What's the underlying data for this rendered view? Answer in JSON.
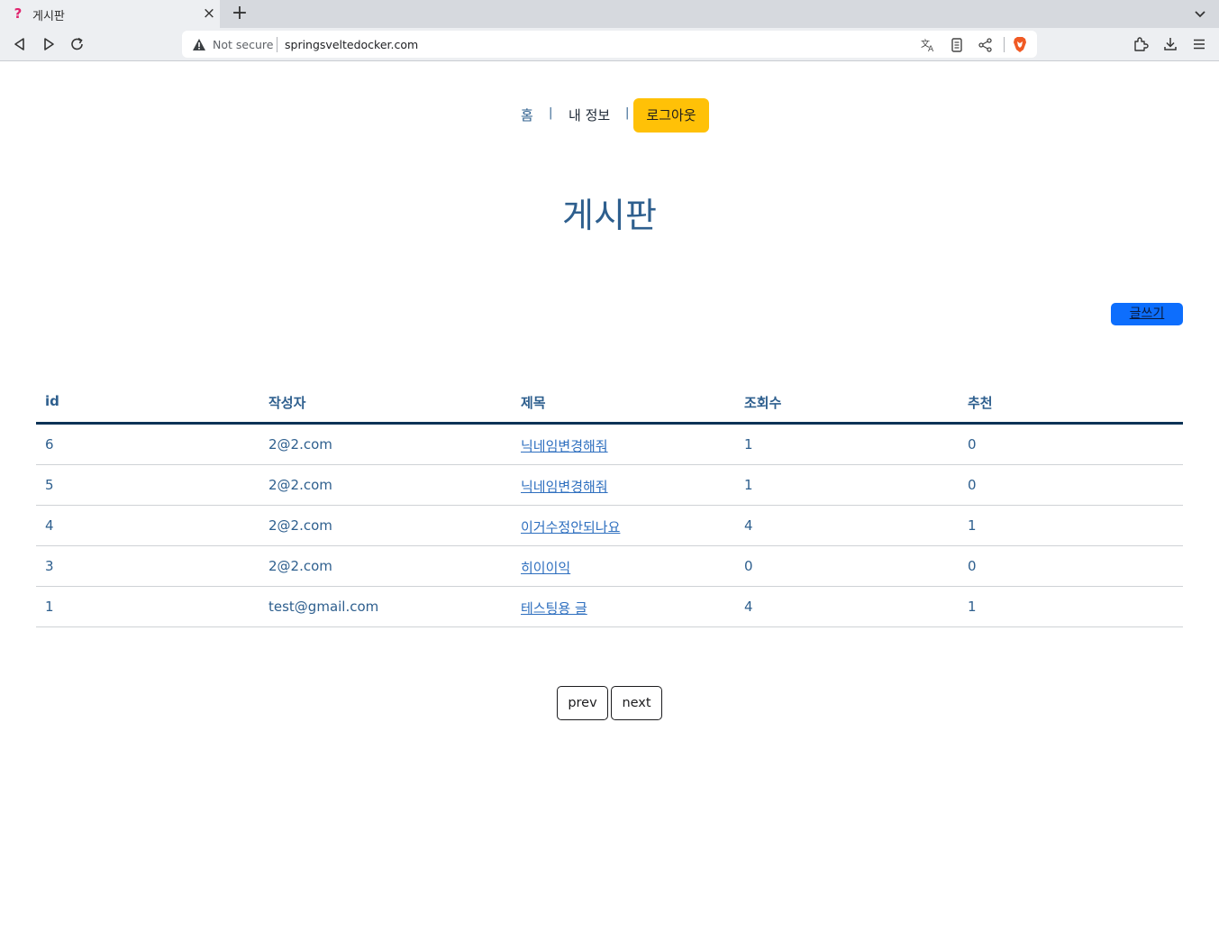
{
  "browser": {
    "tab_title": "게시판",
    "tab_close": "×",
    "new_tab": "+",
    "security_label": "Not secure",
    "url": "springsveltedocker.com"
  },
  "nav": {
    "home": "홈",
    "separator": "|",
    "my_info": "내 정보",
    "logout": "로그아웃"
  },
  "page": {
    "title": "게시판",
    "write_button": "글쓰기"
  },
  "table": {
    "columns": [
      "id",
      "작성자",
      "제목",
      "조회수",
      "추천"
    ],
    "rows": [
      {
        "id": "6",
        "author": "2@2.com",
        "title": "닉네임변경해줘",
        "views": "1",
        "likes": "0"
      },
      {
        "id": "5",
        "author": "2@2.com",
        "title": "닉네임변경해줘",
        "views": "1",
        "likes": "0"
      },
      {
        "id": "4",
        "author": "2@2.com",
        "title": "이거수정안되나요",
        "views": "4",
        "likes": "1"
      },
      {
        "id": "3",
        "author": "2@2.com",
        "title": "히이이익",
        "views": "0",
        "likes": "0"
      },
      {
        "id": "1",
        "author": "test@gmail.com",
        "title": "테스팅용 글",
        "views": "4",
        "likes": "1"
      }
    ]
  },
  "pagination": {
    "prev": "prev",
    "next": "next"
  },
  "colors": {
    "accent_blue": "#2e5f8e",
    "logout_yellow": "#ffc107",
    "write_button_blue": "#0d6efd",
    "header_rule": "#0d3356"
  }
}
